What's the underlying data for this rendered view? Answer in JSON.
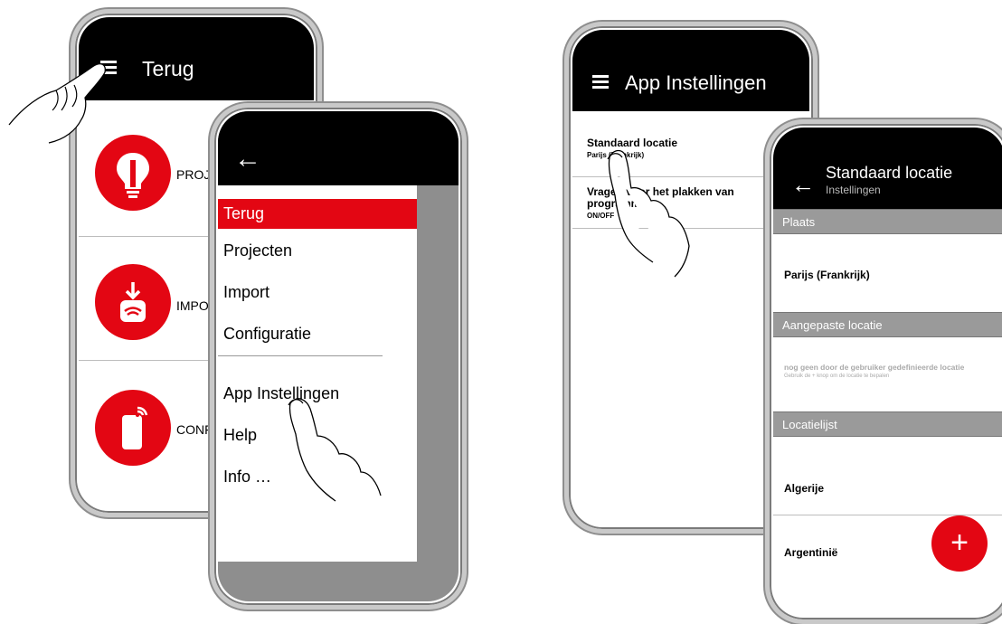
{
  "phone1": {
    "title": "Terug",
    "items": [
      {
        "label": "PROJ"
      },
      {
        "label": "IMPO"
      },
      {
        "label": "CONF"
      }
    ]
  },
  "phone2": {
    "menu": [
      {
        "label": "Terug"
      },
      {
        "label": "Projecten"
      },
      {
        "label": "Import"
      },
      {
        "label": "Configuratie"
      },
      {
        "label": "App Instellingen"
      },
      {
        "label": "Help"
      },
      {
        "label": "Info …"
      }
    ]
  },
  "phone3": {
    "title": "App Instellingen",
    "setting1_title": "Standaard locatie",
    "setting1_value": "Parijs (Frankrijk)",
    "setting2_title": "Vragen voor het plakken van programma's",
    "setting2_value": "ON/OFF"
  },
  "phone4": {
    "title": "Standaard locatie",
    "subtitle": "Instellingen",
    "section_place": "Plaats",
    "place_value": "Parijs (Frankrijk)",
    "section_custom": "Aangepaste locatie",
    "custom_empty": "nog geen door de gebruiker gedefinieerde locatie",
    "custom_hint": "Gebruik de + knop om de locatie te bepalen",
    "section_list": "Locatielijst",
    "list": [
      {
        "label": "Algerije"
      },
      {
        "label": "Argentinië"
      }
    ],
    "fab_label": "+"
  },
  "colors": {
    "accent": "#e30613",
    "bar": "#000000",
    "section": "#9a9a9a"
  },
  "icons": [
    "menu-icon",
    "back-arrow-icon",
    "lightbulb-icon",
    "import-wifi-icon",
    "remote-control-icon",
    "pointing-hand-icon",
    "plus-icon"
  ]
}
